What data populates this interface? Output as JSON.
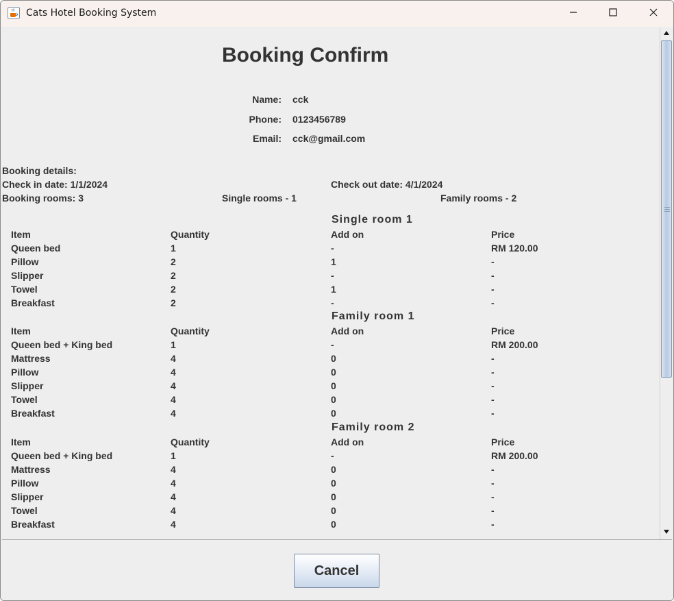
{
  "window": {
    "title": "Cats Hotel Booking System"
  },
  "heading": "Booking Confirm",
  "customer": [
    {
      "label": "Name:",
      "value": "cck"
    },
    {
      "label": "Phone:",
      "value": "0123456789"
    },
    {
      "label": "Email:",
      "value": "cck@gmail.com"
    }
  ],
  "booking": {
    "details_label": "Booking details:",
    "check_in": "Check in date: 1/1/2024",
    "check_out": "Check out date: 4/1/2024",
    "rooms_total": "Booking rooms: 3",
    "single_rooms": "Single rooms - 1",
    "family_rooms": "Family rooms - 2"
  },
  "table_headers": [
    "Item",
    "Quantity",
    "Add on",
    "Price"
  ],
  "rooms": [
    {
      "title": "Single room 1",
      "rows": [
        [
          "Queen bed",
          "1",
          "-",
          "RM 120.00"
        ],
        [
          "Pillow",
          "2",
          "1",
          "-"
        ],
        [
          "Slipper",
          "2",
          "-",
          "-"
        ],
        [
          "Towel",
          "2",
          "1",
          "-"
        ],
        [
          "Breakfast",
          "2",
          "-",
          "-"
        ]
      ]
    },
    {
      "title": "Family room 1",
      "rows": [
        [
          "Queen bed + King bed",
          "1",
          "-",
          "RM 200.00"
        ],
        [
          "Mattress",
          "4",
          "0",
          "-"
        ],
        [
          "Pillow",
          "4",
          "0",
          "-"
        ],
        [
          "Slipper",
          "4",
          "0",
          "-"
        ],
        [
          "Towel",
          "4",
          "0",
          "-"
        ],
        [
          "Breakfast",
          "4",
          "0",
          "-"
        ]
      ]
    },
    {
      "title": "Family room 2",
      "rows": [
        [
          "Queen bed + King bed",
          "1",
          "-",
          "RM 200.00"
        ],
        [
          "Mattress",
          "4",
          "0",
          "-"
        ],
        [
          "Pillow",
          "4",
          "0",
          "-"
        ],
        [
          "Slipper",
          "4",
          "0",
          "-"
        ],
        [
          "Towel",
          "4",
          "0",
          "-"
        ],
        [
          "Breakfast",
          "4",
          "0",
          "-"
        ]
      ]
    }
  ],
  "buttons": {
    "cancel": "Cancel"
  },
  "icons": {
    "app": "java-coffee-cup-icon",
    "minimize": "minimize-icon",
    "maximize": "maximize-icon",
    "close": "close-icon",
    "scroll_up": "arrow-up-icon",
    "scroll_down": "arrow-down-icon"
  }
}
